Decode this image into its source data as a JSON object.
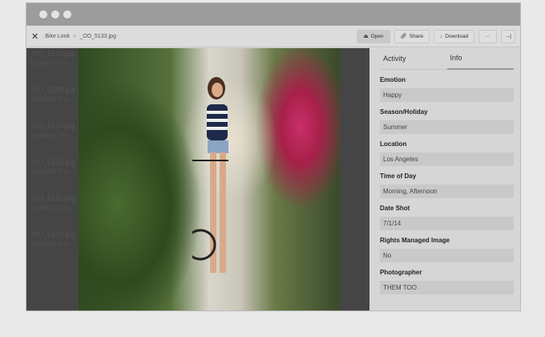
{
  "toolbar": {
    "breadcrumb_parent": "Bike Look",
    "breadcrumb_sep": "›",
    "file": "_OO_5133.jpg",
    "open": "Open",
    "share": "Share",
    "download": "Download",
    "more": "···",
    "collapse": "→|"
  },
  "list": [
    {
      "name": "_OO_5133.jpg",
      "sub": "Uploaded Sep"
    },
    {
      "name": "_OO_5128.jpg",
      "sub": "Uploaded Sep"
    },
    {
      "name": "_OO_5127.jpg",
      "sub": "Uploaded Sep"
    },
    {
      "name": "_OO_5126.jpg",
      "sub": "Uploaded Sep"
    },
    {
      "name": "_OO_5121.jpg",
      "sub": "Uploaded Sep"
    },
    {
      "name": "_OO_5120.jpg",
      "sub": "Uploaded Sep"
    }
  ],
  "panel": {
    "tabs": [
      "Activity",
      "Info"
    ],
    "fields": [
      {
        "label": "Emotion",
        "value": "Happy"
      },
      {
        "label": "Season/Holiday",
        "value": "Summer"
      },
      {
        "label": "Location",
        "value": "Los Angeles"
      },
      {
        "label": "Time of Day",
        "value": "Morning, Afternoon"
      },
      {
        "label": "Date Shot",
        "value": "7/1/14"
      },
      {
        "label": "Rights Managed Image",
        "value": "No"
      },
      {
        "label": "Photographer",
        "value": "THEM TOO"
      }
    ]
  }
}
